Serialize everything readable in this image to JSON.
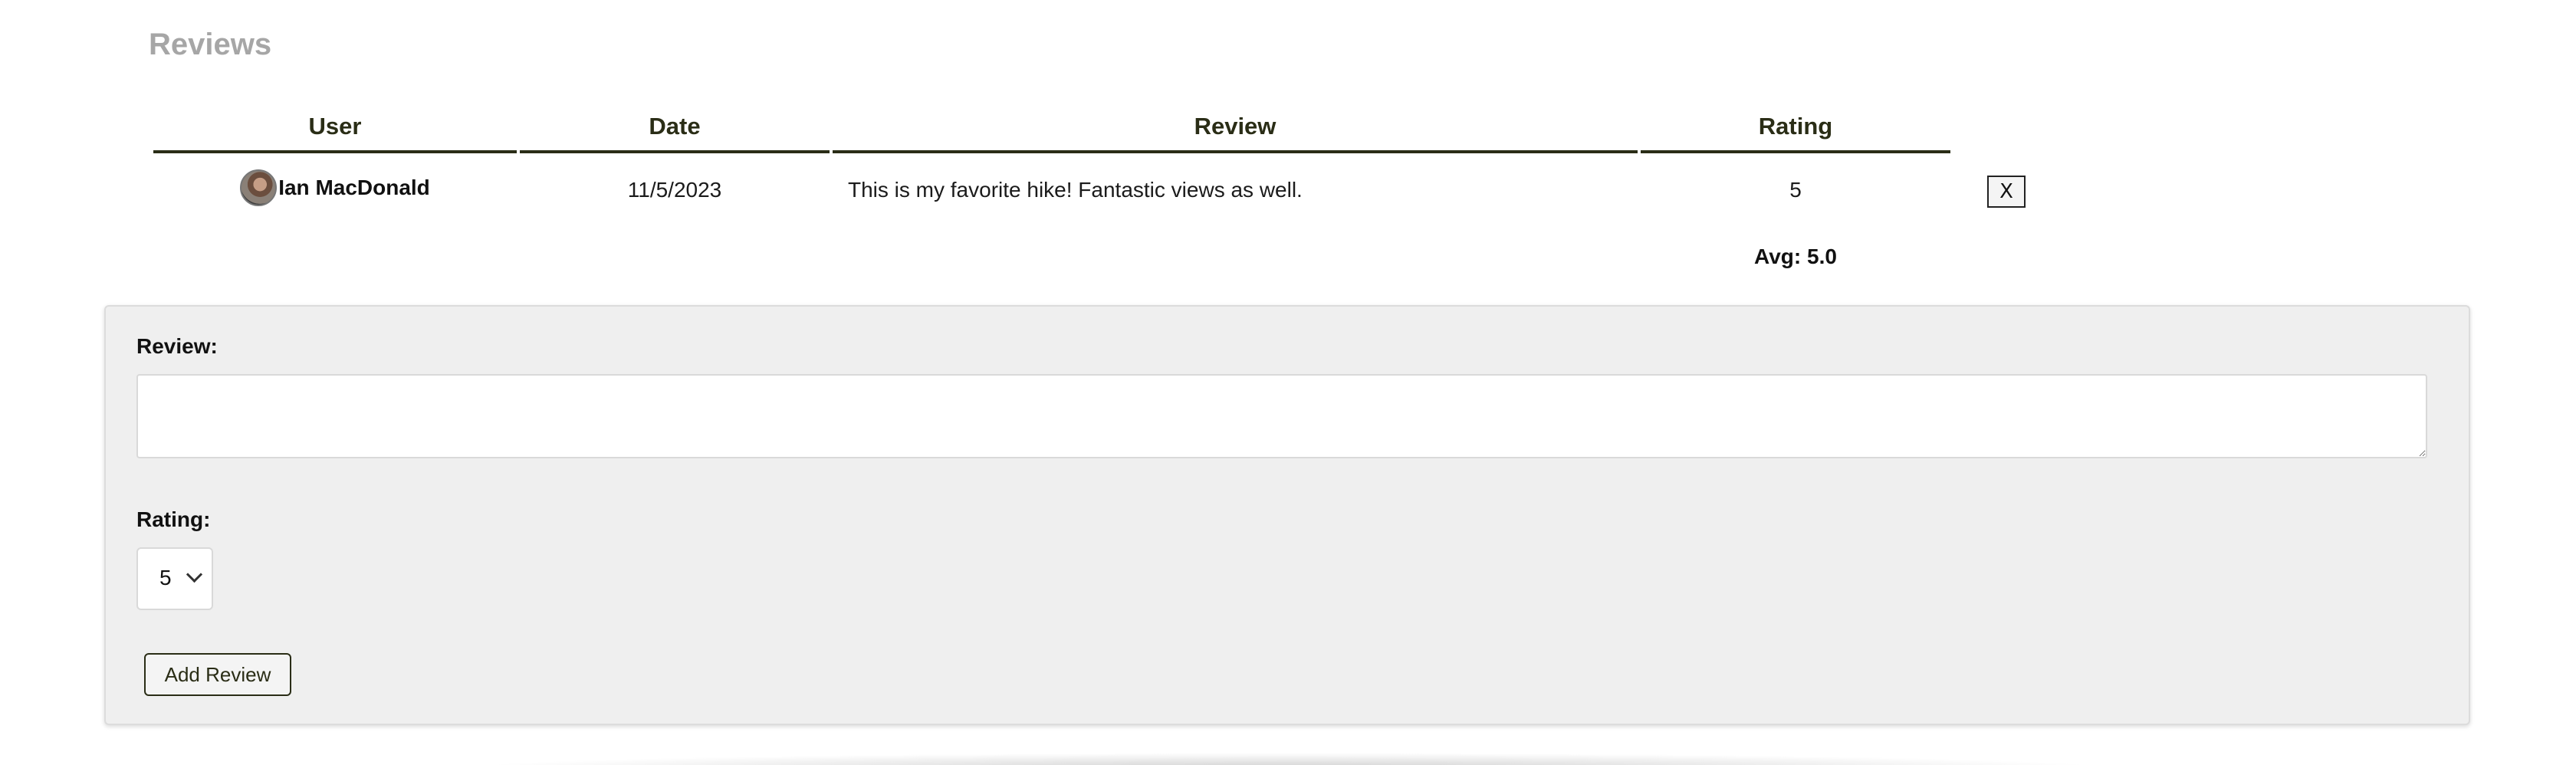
{
  "section": {
    "title": "Reviews"
  },
  "table": {
    "headers": {
      "user": "User",
      "date": "Date",
      "review": "Review",
      "rating": "Rating"
    },
    "rows": [
      {
        "user": "Ian MacDonald",
        "date": "11/5/2023",
        "review": "This is my favorite hike! Fantastic views as well.",
        "rating": "5",
        "delete_label": "X"
      }
    ],
    "average": "Avg: 5.0"
  },
  "form": {
    "review_label": "Review:",
    "review_value": "",
    "rating_label": "Rating:",
    "rating_value": "5",
    "submit_label": "Add Review"
  },
  "colors": {
    "heading_gray": "#a6a6a6",
    "header_olive": "#2a2d16",
    "panel_bg": "#efefef"
  }
}
